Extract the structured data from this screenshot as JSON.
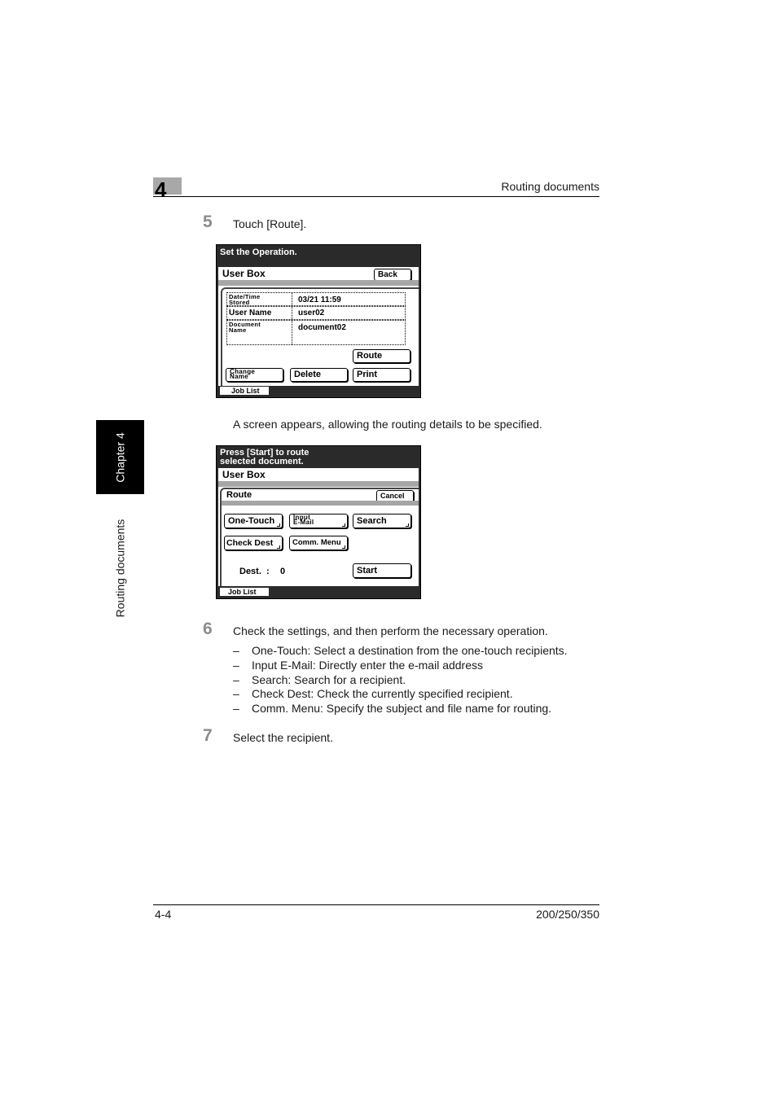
{
  "header": {
    "chapter_number": "4",
    "section_title": "Routing documents"
  },
  "side_tab": {
    "chapter_label": "Chapter 4",
    "section_label": "Routing documents"
  },
  "steps": [
    {
      "number": "5",
      "text": "Touch [Route]."
    },
    {
      "number": "6",
      "text": "Check the settings, and then perform the necessary operation."
    },
    {
      "number": "7",
      "text": "Select the recipient."
    }
  ],
  "between_screens_text": "A screen appears, allowing the routing details to be specified.",
  "bullets": {
    "dash": "–",
    "items": [
      "One-Touch: Select a destination from the one-touch recipients.",
      "Input E-Mail: Directly enter the e-mail address",
      "Search: Search for a recipient.",
      "Check Dest: Check the currently specified recipient.",
      "Comm. Menu: Specify the subject and file name for routing."
    ]
  },
  "screen1": {
    "title": "Set the Operation.",
    "userbox_label": "User Box",
    "back_button": "Back",
    "rows": [
      {
        "label_line1": "Date/Time",
        "label_line2": "Stored",
        "value": "03/21  11:59"
      },
      {
        "label": "User Name",
        "value": "user02"
      },
      {
        "label_line1": "Document",
        "label_line2": "Name",
        "value": "document02"
      }
    ],
    "route_button": "Route",
    "change_name_line1": "Change",
    "change_name_line2": "Name",
    "delete_button": "Delete",
    "print_button": "Print",
    "job_list": "Job List"
  },
  "screen2": {
    "title_line1": "Press [Start] to route",
    "title_line2": "selected document.",
    "userbox_label": "User Box",
    "panel_title": "Route",
    "cancel_button": "Cancel",
    "one_touch_button": "One-Touch",
    "input_email_line1": "Input",
    "input_email_line2": "E-Mail",
    "search_button": "Search",
    "check_dest_button": "Check Dest",
    "comm_menu_button": "Comm. Menu",
    "dest_label": "Dest.  :",
    "dest_count": "0",
    "start_button": "Start",
    "job_list": "Job List"
  },
  "footer": {
    "page_number": "4-4",
    "model": "200/250/350"
  }
}
